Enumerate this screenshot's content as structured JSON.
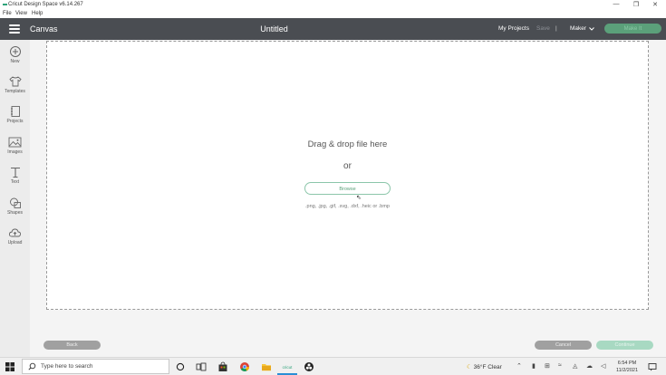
{
  "window": {
    "title": "Cricut Design Space  v6.14.267",
    "controls": [
      "—",
      "❐",
      "✕"
    ]
  },
  "menu": [
    "File",
    "View",
    "Help"
  ],
  "header": {
    "section": "Canvas",
    "project_title": "Untitled",
    "my_projects": "My Projects",
    "save": "Save",
    "separator": "|",
    "machine": "Maker",
    "make_it": "Make It"
  },
  "sidebar": [
    {
      "label": "New",
      "icon": "plus-circle-icon"
    },
    {
      "label": "Templates",
      "icon": "shirt-icon"
    },
    {
      "label": "Projects",
      "icon": "notebook-icon"
    },
    {
      "label": "Images",
      "icon": "image-icon"
    },
    {
      "label": "Text",
      "icon": "text-icon"
    },
    {
      "label": "Shapes",
      "icon": "shapes-icon"
    },
    {
      "label": "Upload",
      "icon": "cloud-upload-icon"
    }
  ],
  "dropzone": {
    "title": "Drag & drop file here",
    "or": "or",
    "browse": "Browse",
    "formats": ".png, .jpg, .gif, .svg, .dxf, .heic or .bmp"
  },
  "footer": {
    "back": "Back",
    "cancel": "Cancel",
    "continue": "Continue"
  },
  "taskbar": {
    "search_placeholder": "Type here to search",
    "weather": "36°F  Clear",
    "time": "6:54 PM",
    "date": "11/2/2021",
    "pinned": [
      "cortana-icon",
      "task-view-icon",
      "store-icon",
      "chrome-icon",
      "file-explorer-icon",
      "cricut-icon",
      "obs-icon"
    ]
  },
  "colors": {
    "header_bg": "#4a4d52",
    "accent_green": "#5ba07a",
    "sidebar_bg": "#ececec"
  }
}
